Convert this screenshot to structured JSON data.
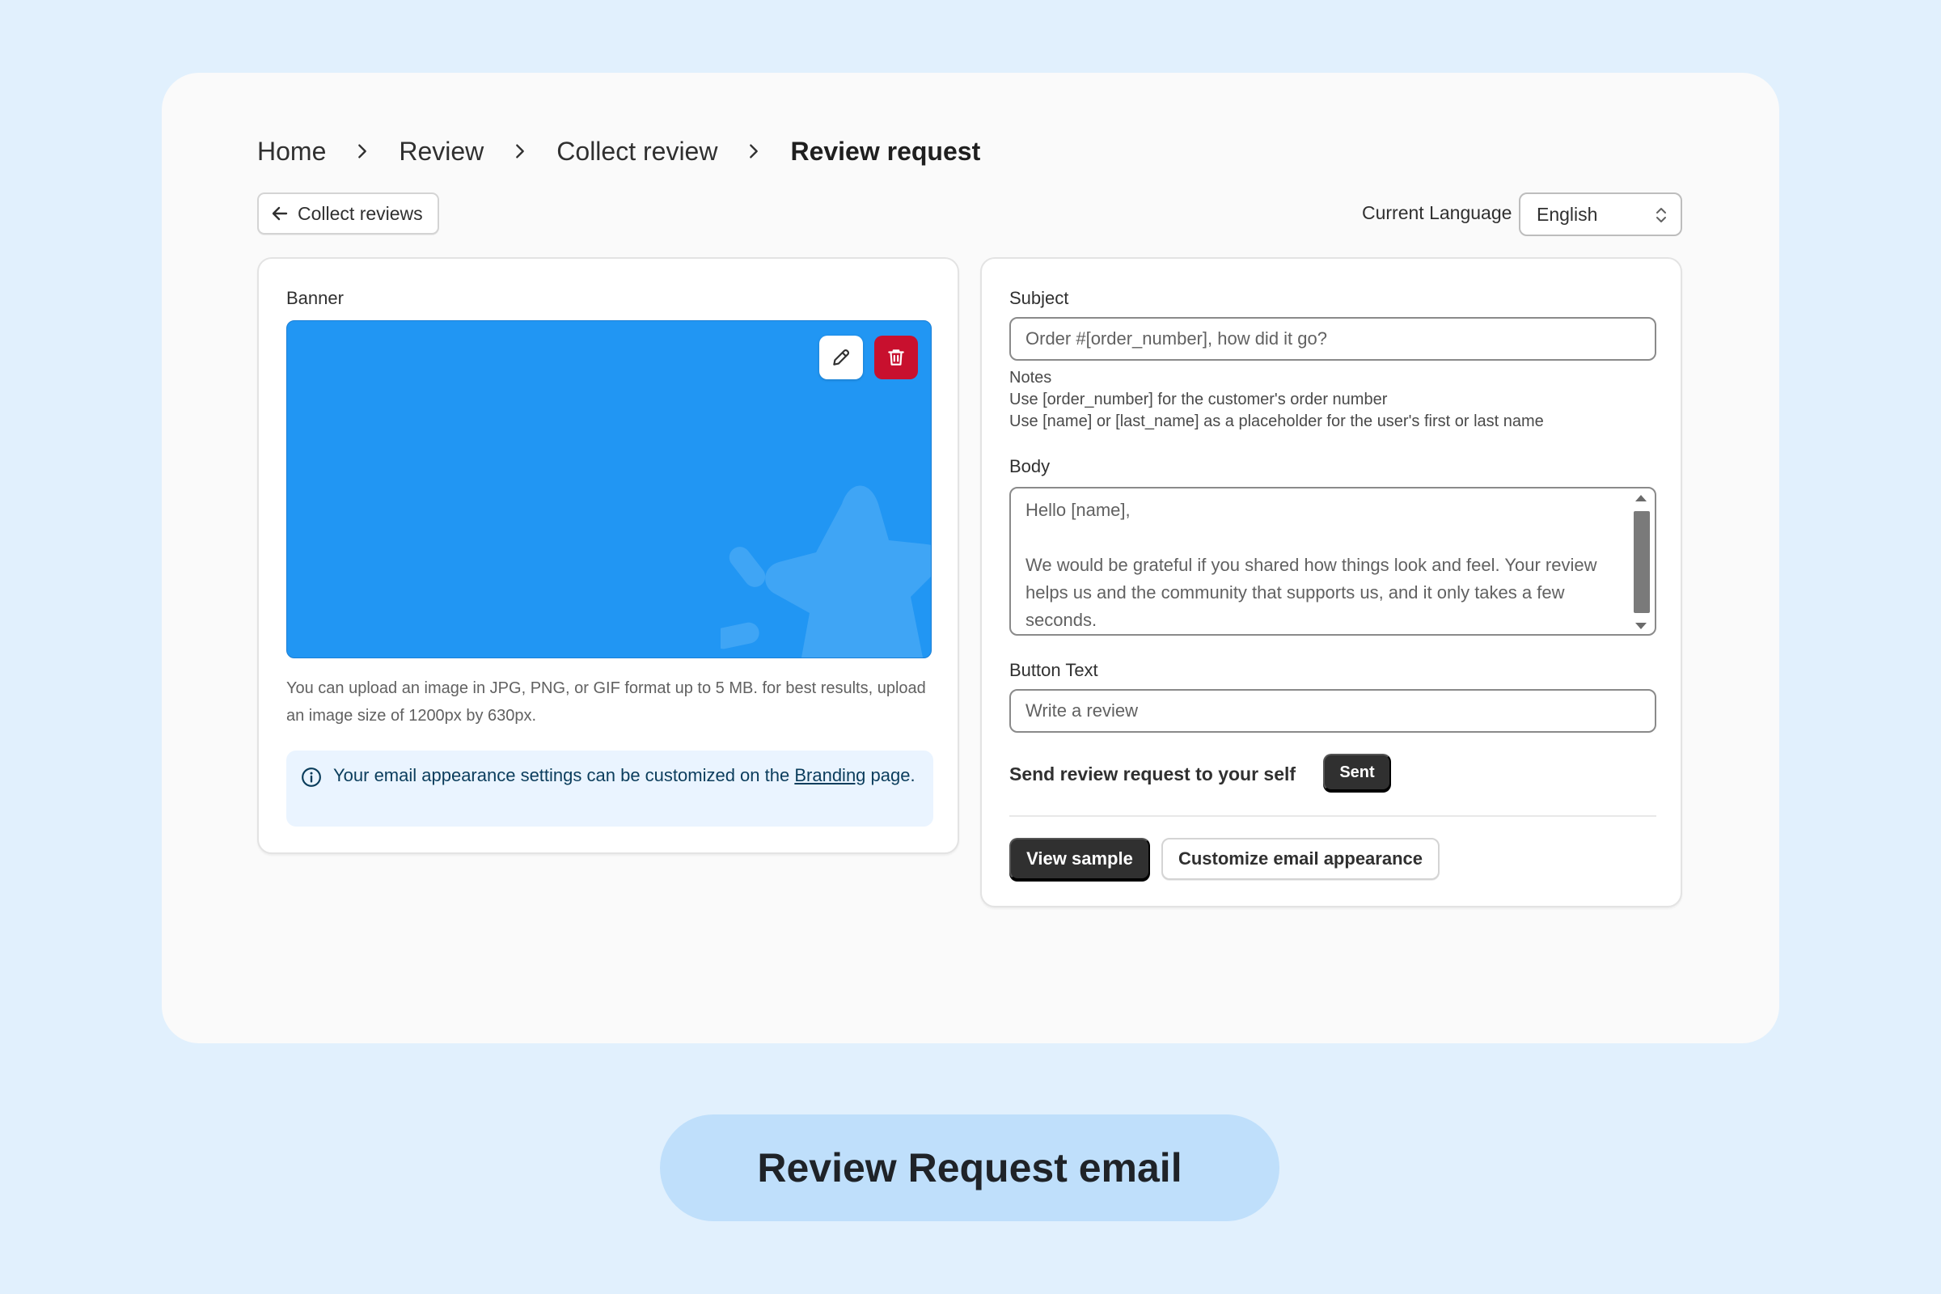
{
  "breadcrumb": {
    "items": [
      "Home",
      "Review",
      "Collect review"
    ],
    "current": "Review request"
  },
  "toolbar": {
    "back_label": "Collect reviews",
    "language_label": "Current Language",
    "language_value": "English"
  },
  "banner_section": {
    "label": "Banner",
    "help_text": "You can upload an image in JPG, PNG, or GIF format up to 5 MB. for best results, upload an image size of 1200px by 630px.",
    "info_prefix": "Your email appearance settings can be customized on the",
    "info_link": "Branding",
    "info_suffix": "page.",
    "colors": {
      "banner": "#2196f3",
      "delete": "#c8102e"
    },
    "icons": [
      "pencil-icon",
      "trash-icon",
      "info-icon"
    ]
  },
  "email_form": {
    "subject_label": "Subject",
    "subject_value": "Order #[order_number], how did it go?",
    "notes_title": "Notes",
    "notes": [
      "Use [order_number] for the customer's order number",
      "Use [name] or [last_name] as a placeholder for the user's first or last name"
    ],
    "body_label": "Body",
    "body_greeting": "Hello [name],",
    "body_text": "We would be grateful if you shared how things look and feel. Your review helps us and the community that supports us, and it only takes a few seconds.",
    "button_text_label": "Button Text",
    "button_text_value": "Write a review",
    "send_self_label": "Send review request to your self",
    "sent_label": "Sent",
    "view_sample_label": "View sample",
    "customize_label": "Customize email appearance"
  },
  "caption": "Review Request email"
}
